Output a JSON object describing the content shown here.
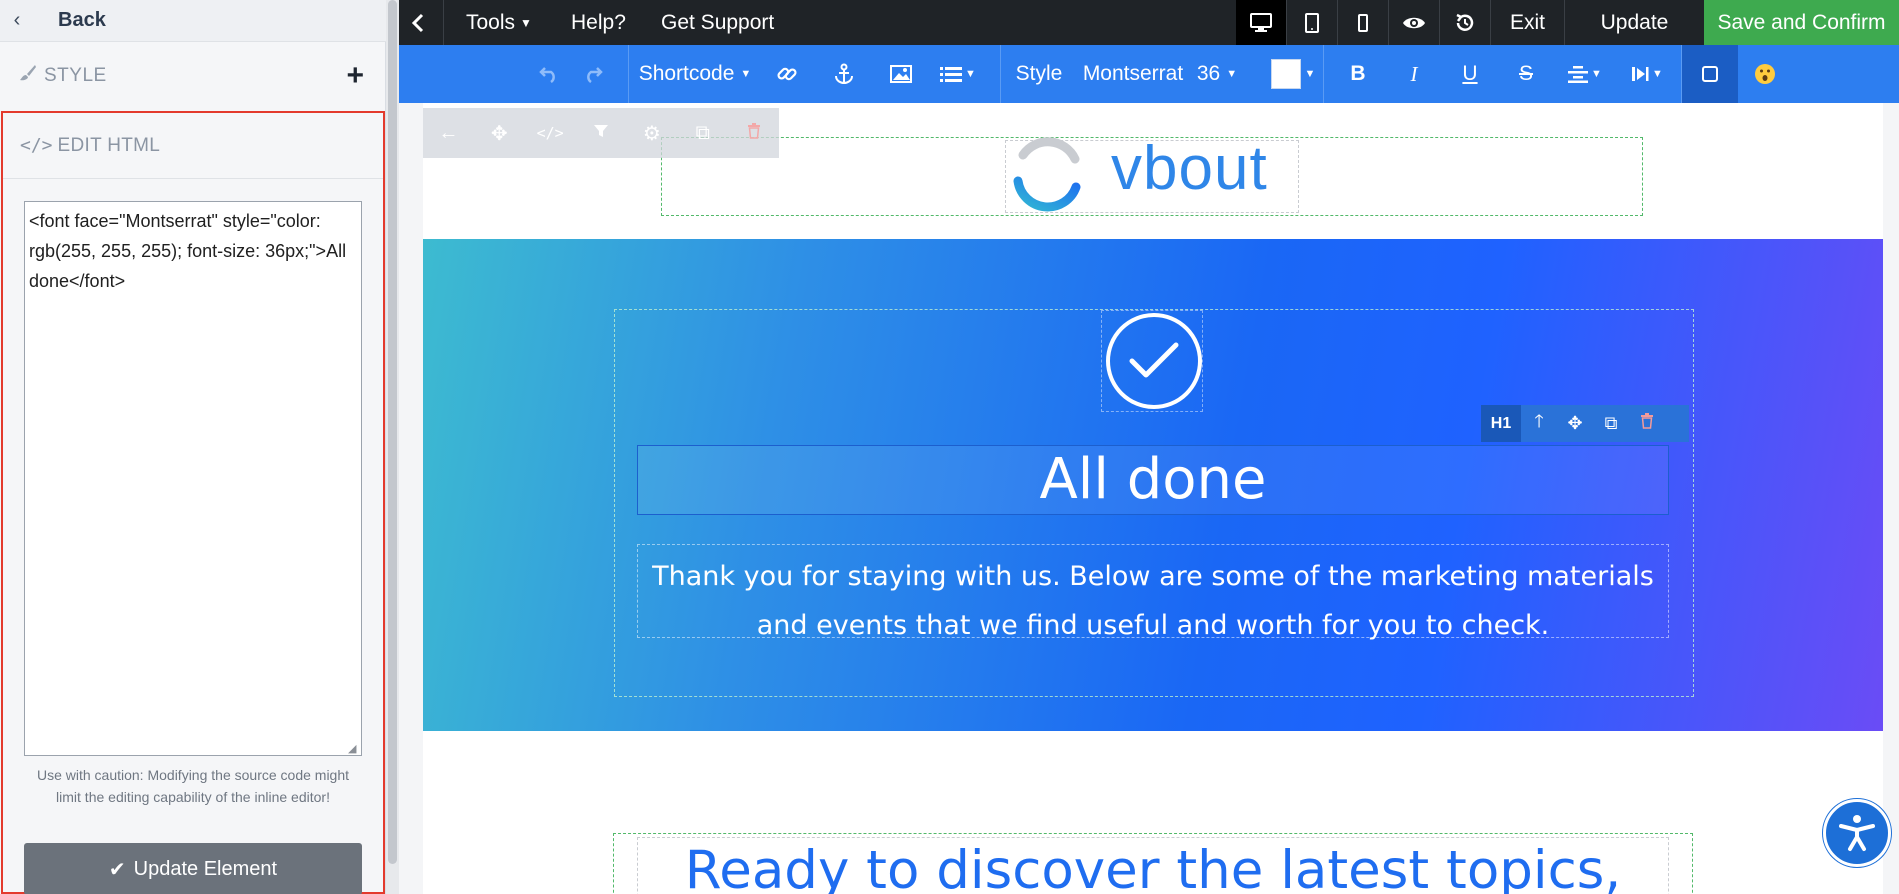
{
  "sidebar": {
    "back_label": "Back",
    "style_label": "STYLE",
    "edit_html_label": "EDIT HTML",
    "code": "<font face=\"Montserrat\" style=\"color: rgb(255, 255, 255); font-size: 36px;\">All done</font>",
    "caution": "Use with caution: Modifying the source code might limit the editing capability of the inline editor!",
    "update_button": "Update Element"
  },
  "topbar": {
    "tools": "Tools",
    "help": "Help?",
    "support": "Get Support",
    "exit": "Exit",
    "update": "Update",
    "save_confirm": "Save and Confirm"
  },
  "toolbar": {
    "shortcode": "Shortcode",
    "style": "Style",
    "font": "Montserrat",
    "size": "36",
    "bold": "B",
    "italic": "I",
    "underline": "U",
    "strike": "S"
  },
  "canvas": {
    "logo_text": "vbout",
    "h1_tag": "H1",
    "heading": "All done",
    "paragraph": "Thank you for staying with us. Below are some of the marketing materials and events that we find useful and worth for you to check.",
    "discover": "Ready to discover the latest topics,"
  },
  "colors": {
    "topbar": "#1f2327",
    "toolbar": "#2d7ef0",
    "save_green": "#3eaa4f",
    "highlight_red": "#e33a2d",
    "hero_start": "#3dbbd0",
    "hero_mid": "#1a67f5",
    "hero_end": "#6a4cf6"
  }
}
